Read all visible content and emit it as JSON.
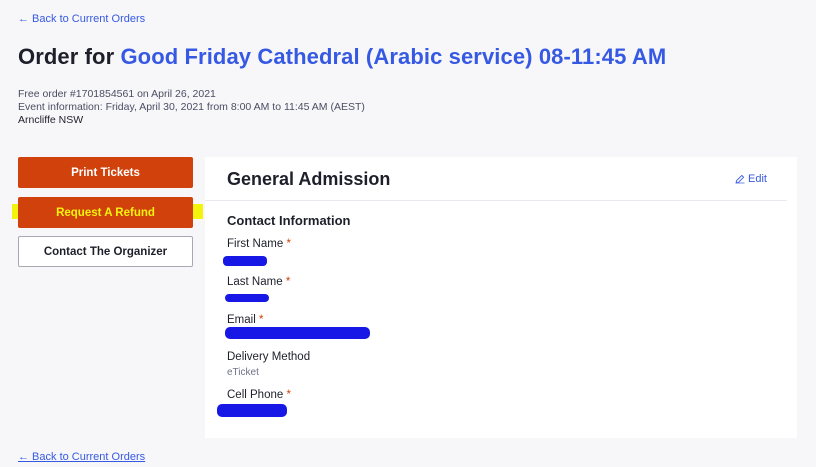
{
  "nav": {
    "back_top": "← Back to Current Orders",
    "back_bottom": "← Back to Current Orders"
  },
  "order": {
    "title_prefix": "Order for",
    "event_name": "Good Friday Cathedral (Arabic service) 08-11:45 AM",
    "order_line": "Free order #1701854561 on April 26, 2021",
    "event_info_label": "Event information:",
    "event_info_value": "Friday, April 30, 2021 from 8:00 AM to 11:45 AM (AEST)",
    "location": "Arncliffe NSW"
  },
  "actions": {
    "print": "Print Tickets",
    "refund": "Request A Refund",
    "contact": "Contact The Organizer"
  },
  "ticket": {
    "type": "General Admission",
    "edit_label": "Edit",
    "section_title": "Contact Information",
    "required_mark": "*",
    "fields": {
      "first_name": "First Name",
      "last_name": "Last Name",
      "email": "Email",
      "delivery_method": "Delivery Method",
      "delivery_value": "eTicket",
      "cell_phone": "Cell Phone"
    }
  },
  "colors": {
    "accent": "#3659e3",
    "primary_button": "#d1410c",
    "highlight": "#f3f30e",
    "redaction": "#1818e6"
  },
  "icons": {
    "edit": "pencil-icon"
  }
}
